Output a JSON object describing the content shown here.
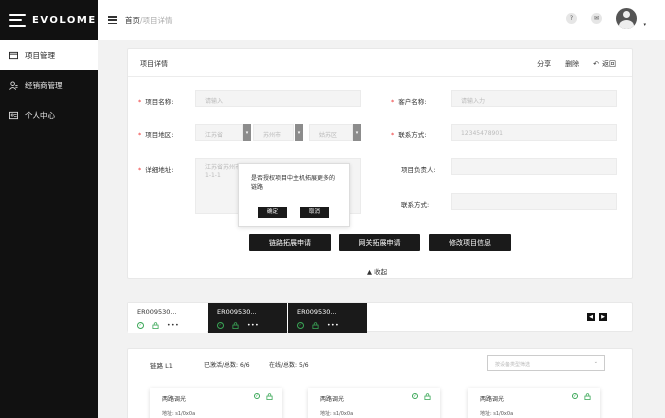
{
  "app": {
    "logo_text": "EVOLOME"
  },
  "sidebar": {
    "items": [
      {
        "label": "项目管理",
        "icon": "folder-icon",
        "active": true
      },
      {
        "label": "经销商管理",
        "icon": "user-group-icon",
        "active": false
      },
      {
        "label": "个人中心",
        "icon": "id-card-icon",
        "active": false
      }
    ]
  },
  "header": {
    "breadcrumb_home": "首页",
    "breadcrumb_sep": "/",
    "breadcrumb_current": "项目详情",
    "help_glyph": "?",
    "message_glyph": "✉",
    "caret_glyph": "▾"
  },
  "detail": {
    "title": "项目详情",
    "actions": {
      "share": "分享",
      "delete": "删除",
      "back": "返回",
      "back_glyph": "↶"
    },
    "fields": {
      "project_name_label": "项目名称:",
      "project_name_placeholder": "请输入",
      "customer_name_label": "客户名称:",
      "customer_name_placeholder": "请输入力",
      "region_label": "项目地区:",
      "province": "江苏省",
      "city": "苏州市",
      "district": "姑苏区",
      "contact_label": "联系方式:",
      "contact_value": "12345478901",
      "address_label": "详细地址:",
      "address_value": "江苏省苏州市",
      "address_value2": "1-1-1",
      "owner_label": "项目负责人:",
      "contact2_label": "联系方式:"
    },
    "required_mark": "*",
    "select_arrow_glyph": "▾",
    "buttons": {
      "link_extend": "链路拓展申请",
      "gateway_extend": "网关拓展申请",
      "modify": "修改项目信息"
    },
    "collapse_label": "▲ 收起"
  },
  "popover": {
    "message": "是否授权项目中主机拓展更多的链路",
    "confirm": "确定",
    "cancel": "取消"
  },
  "devices": {
    "items": [
      {
        "name": "ER009530...",
        "style": "light"
      },
      {
        "name": "ER009530...",
        "style": "dark"
      },
      {
        "name": "ER009530...",
        "style": "dark"
      }
    ],
    "check_glyph": "✓",
    "dots": "•••",
    "prev_glyph": "◀",
    "next_glyph": "▶"
  },
  "links": {
    "title": "链路 L1",
    "stat_registered": "已激活/总数: 6/6",
    "stat_online": "在线/总数: 5/6",
    "select_placeholder": "按设备类型筛选",
    "select_chevron": "⌄",
    "cards": [
      {
        "title": "两路调光",
        "sub": "地址: s1/0x0a"
      },
      {
        "title": "两路调光",
        "sub": "地址: s1/0x0a"
      },
      {
        "title": "两路调光",
        "sub": "地址: s1/0x0a"
      }
    ]
  },
  "colors": {
    "sidebar_bg": "#111111",
    "dark_button": "#1a1a1a",
    "status_ok": "#3aa757",
    "required": "#ee3333"
  }
}
